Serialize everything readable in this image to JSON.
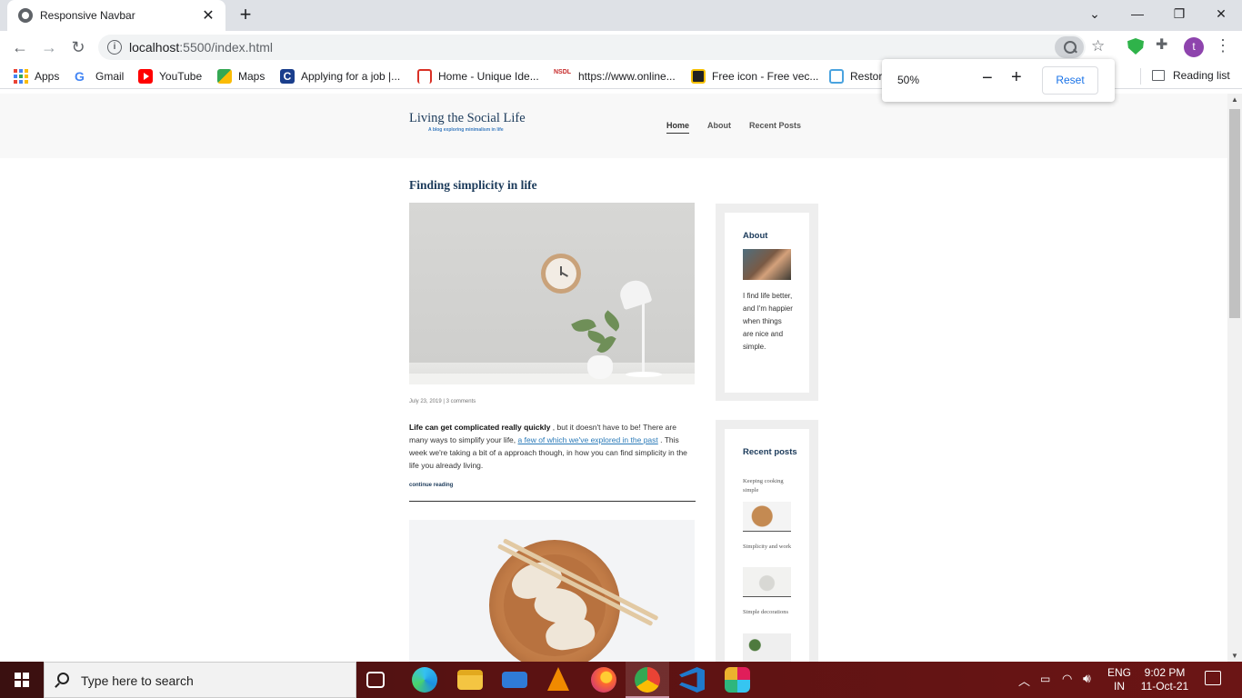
{
  "browser": {
    "tab_title": "Responsive Navbar",
    "url_host": "localhost",
    "url_path": ":5500/index.html",
    "avatar_letter": "t",
    "zoom": {
      "percent": "50%",
      "reset_label": "Reset"
    }
  },
  "bookmarks": [
    {
      "label": "Apps",
      "icon": "apps-icon"
    },
    {
      "label": "Gmail",
      "icon": "google-icon"
    },
    {
      "label": "YouTube",
      "icon": "youtube-icon"
    },
    {
      "label": "Maps",
      "icon": "maps-icon"
    },
    {
      "label": "Applying for a job |...",
      "icon": "c-icon"
    },
    {
      "label": "Home - Unique Ide...",
      "icon": "wifi-icon"
    },
    {
      "label": "https://www.online...",
      "icon": "nsdl-icon"
    },
    {
      "label": "Free icon - Free vec...",
      "icon": "free-icon"
    },
    {
      "label": "Restor",
      "icon": "restore-icon"
    }
  ],
  "reading_list_label": "Reading list",
  "site": {
    "brand": "Living the Social Life",
    "tagline": "A blog exploring minimalism in life",
    "nav": [
      "Home",
      "About",
      "Recent Posts"
    ],
    "post": {
      "title": "Finding simplicity in life",
      "meta": "July 23, 2019 | 3 comments",
      "bold_lead": "Life can get complicated really quickly",
      "text_1": ", but it doesn't have to be! There are many ways to simplify your life,",
      "link_text": "a few of which we've explored in the past",
      "text_2": ". This week we're taking a bit of a approach though, in how you can find simplicity in the life you already living.",
      "continue": "continue reading"
    },
    "sidebar": {
      "about_title": "About",
      "about_text": "I find life better, and I'm happier when things are nice and simple.",
      "recent_title": "Recent posts",
      "recent_posts": [
        "Keeping cooking simple",
        "Simplicity and work",
        "Simple decorations"
      ]
    }
  },
  "taskbar": {
    "search_placeholder": "Type here to search",
    "lang_top": "ENG",
    "lang_bottom": "IN",
    "time": "9:02 PM",
    "date": "11-Oct-21"
  }
}
